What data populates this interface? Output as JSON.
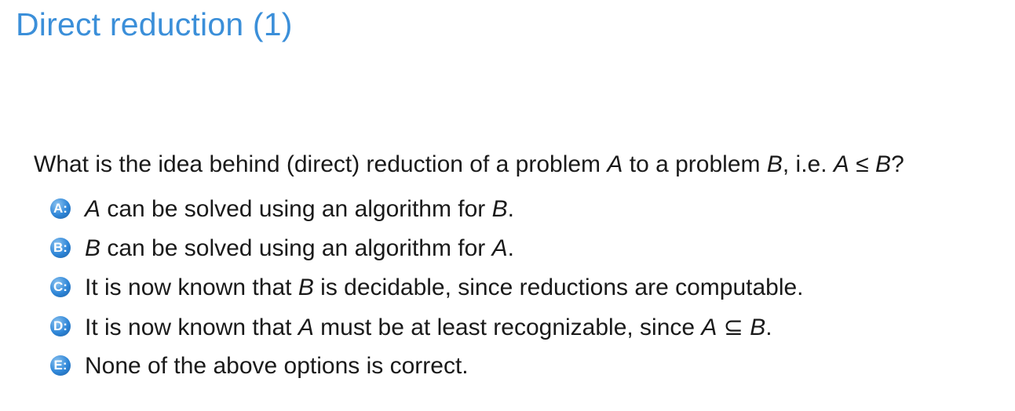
{
  "slide": {
    "title": "Direct reduction (1)",
    "title_color": "#3b8fd9"
  },
  "question": {
    "text_before": "What is the idea behind (direct) reduction of a problem ",
    "var_a": "A",
    "text_mid": " to a problem ",
    "var_b": "B",
    "text_ie": ", i.e. ",
    "rel_lhs": "A",
    "rel_op": " ≤ ",
    "rel_rhs": "B",
    "text_end": "?"
  },
  "badge_color": "#2e86d8",
  "options": [
    {
      "letter": "A:",
      "parts": [
        {
          "text": "A",
          "italic": true
        },
        {
          "text": " can be solved using an algorithm for ",
          "italic": false
        },
        {
          "text": "B",
          "italic": true
        },
        {
          "text": ".",
          "italic": false
        }
      ]
    },
    {
      "letter": "B:",
      "parts": [
        {
          "text": "B",
          "italic": true
        },
        {
          "text": " can be solved using an algorithm for ",
          "italic": false
        },
        {
          "text": "A",
          "italic": true
        },
        {
          "text": ".",
          "italic": false
        }
      ]
    },
    {
      "letter": "C:",
      "parts": [
        {
          "text": "It is now known that ",
          "italic": false
        },
        {
          "text": "B",
          "italic": true
        },
        {
          "text": " is decidable, since reductions are computable.",
          "italic": false
        }
      ]
    },
    {
      "letter": "D:",
      "parts": [
        {
          "text": "It is now known that ",
          "italic": false
        },
        {
          "text": "A",
          "italic": true
        },
        {
          "text": " must be at least recognizable, since ",
          "italic": false
        },
        {
          "text": "A",
          "italic": true
        },
        {
          "text": " ⊆ ",
          "italic": false
        },
        {
          "text": "B",
          "italic": true
        },
        {
          "text": ".",
          "italic": false
        }
      ]
    },
    {
      "letter": "E:",
      "parts": [
        {
          "text": "None of the above options is correct.",
          "italic": false
        }
      ]
    }
  ]
}
